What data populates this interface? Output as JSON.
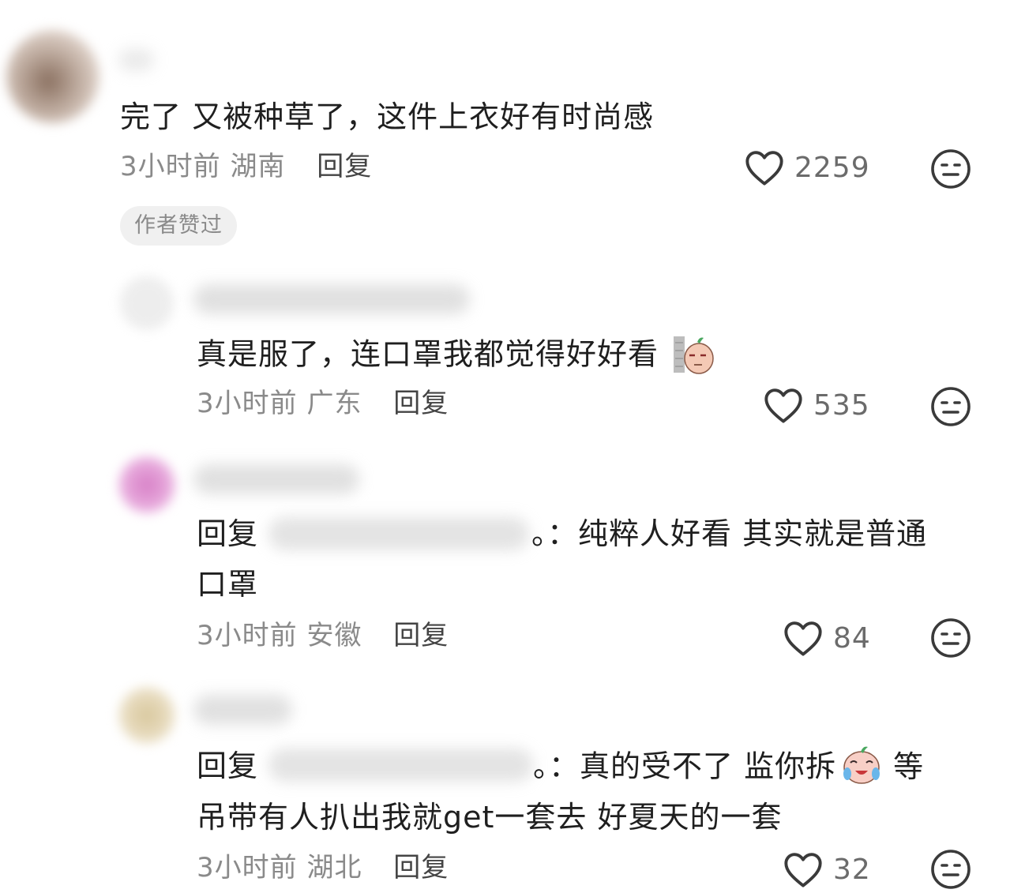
{
  "comments": [
    {
      "text": "完了 又被种草了，这件上衣好有时尚感",
      "time": "3小时前",
      "location": "湖南",
      "reply_label": "回复",
      "likes": "2259",
      "badge": "作者赞过"
    },
    {
      "text": "真是服了，连口罩我都觉得好好看",
      "time": "3小时前",
      "location": "广东",
      "reply_label": "回复",
      "likes": "535"
    },
    {
      "reply_prefix": "回复",
      "text_line1": "。：纯粹人好看 其实就是普通",
      "text_line2": "口罩",
      "time": "3小时前",
      "location": "安徽",
      "reply_label": "回复",
      "likes": "84"
    },
    {
      "reply_prefix": "回复",
      "text_line1_a": "。：真的受不了 监你拆",
      "text_line1_b": "等",
      "text_line2": "吊带有人扒出我就get一套去 好夏天的一套",
      "time": "3小时前",
      "location": "湖北",
      "reply_label": "回复",
      "likes": "32"
    }
  ],
  "icons": {
    "like": "heart-outline-icon",
    "dislike": "meh-face-icon"
  },
  "colors": {
    "text": "#1f1f1f",
    "meta": "#8a8a8a",
    "badge_bg": "#f0f0f0"
  }
}
